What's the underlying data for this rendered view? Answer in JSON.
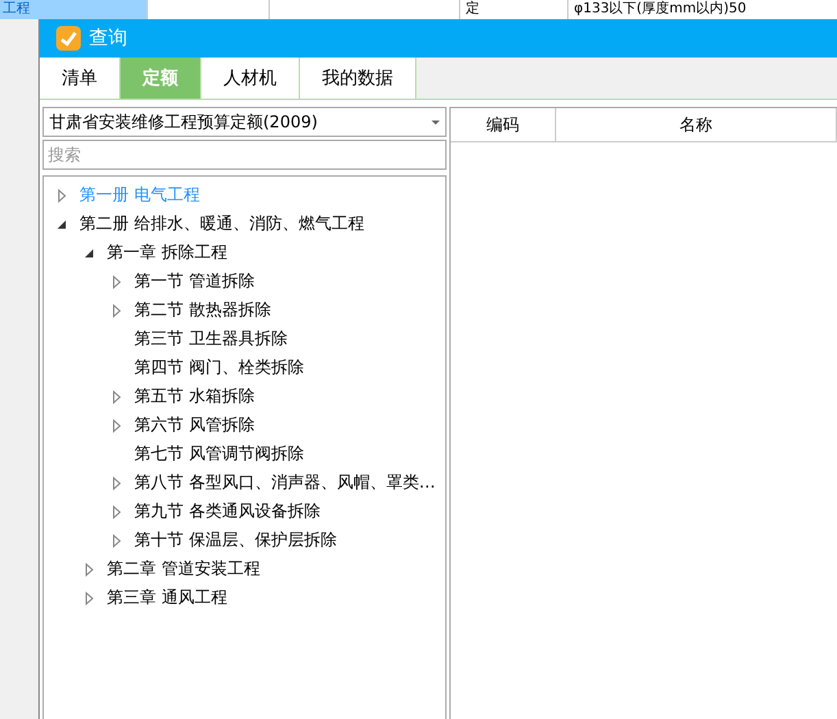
{
  "background": {
    "selected_item": "工程",
    "cell_type": "定",
    "cell_name": "φ133以下(厚度mm以内)50"
  },
  "window": {
    "title": "查询"
  },
  "tabs": [
    {
      "label": "清单",
      "selected": false
    },
    {
      "label": "定额",
      "selected": true
    },
    {
      "label": "人材机",
      "selected": false
    },
    {
      "label": "我的数据",
      "selected": false
    }
  ],
  "library_dropdown": {
    "value": "甘肃省安装维修工程预算定额(2009)"
  },
  "search": {
    "placeholder": "搜索"
  },
  "tree": [
    {
      "label": "第一册 电气工程",
      "kind": "branch",
      "expanded": false,
      "selected": true
    },
    {
      "label": "第二册 给排水、暖通、消防、燃气工程",
      "kind": "branch",
      "expanded": true,
      "selected": false,
      "children": [
        {
          "label": "第一章 拆除工程",
          "kind": "branch",
          "expanded": true,
          "selected": false,
          "children": [
            {
              "label": "第一节 管道拆除",
              "kind": "branch",
              "expanded": false,
              "selected": false
            },
            {
              "label": "第二节 散热器拆除",
              "kind": "branch",
              "expanded": false,
              "selected": false
            },
            {
              "label": "第三节 卫生器具拆除",
              "kind": "leaf",
              "selected": false
            },
            {
              "label": "第四节 阀门、栓类拆除",
              "kind": "leaf",
              "selected": false
            },
            {
              "label": "第五节 水箱拆除",
              "kind": "branch",
              "expanded": false,
              "selected": false
            },
            {
              "label": "第六节 风管拆除",
              "kind": "branch",
              "expanded": false,
              "selected": false
            },
            {
              "label": "第七节 风管调节阀拆除",
              "kind": "leaf",
              "selected": false
            },
            {
              "label": "第八节 各型风口、消声器、风帽、罩类…",
              "kind": "branch",
              "expanded": false,
              "selected": false
            },
            {
              "label": "第九节 各类通风设备拆除",
              "kind": "branch",
              "expanded": false,
              "selected": false
            },
            {
              "label": "第十节 保温层、保护层拆除",
              "kind": "branch",
              "expanded": false,
              "selected": false
            }
          ]
        },
        {
          "label": "第二章 管道安装工程",
          "kind": "branch",
          "expanded": false,
          "selected": false
        },
        {
          "label": "第三章 通风工程",
          "kind": "branch",
          "expanded": false,
          "selected": false
        }
      ]
    }
  ],
  "table": {
    "columns": [
      "编码",
      "名称"
    ]
  }
}
